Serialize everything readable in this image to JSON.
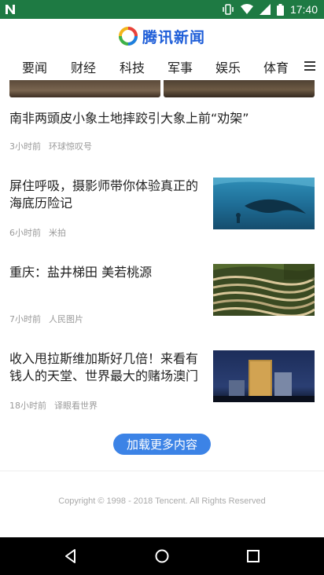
{
  "status_bar": {
    "time": "17:40"
  },
  "app": {
    "logo_text": "腾讯新闻"
  },
  "tabs": [
    {
      "label": "要闻"
    },
    {
      "label": "财经"
    },
    {
      "label": "科技"
    },
    {
      "label": "军事"
    },
    {
      "label": "娱乐"
    },
    {
      "label": "体育"
    }
  ],
  "stories": [
    {
      "title": "南非两頭皮小象土地摔跤引大象上前“劝架”",
      "time": "3小时前",
      "source": "环球惊叹号"
    },
    {
      "title": "屏住呼吸，摄影师带你体验真正的海底历险记",
      "time": "6小时前",
      "source": "米拍"
    },
    {
      "title": "重庆：盐井梯田 美若桃源",
      "time": "7小时前",
      "source": "人民图片"
    },
    {
      "title": "收入甩拉斯维加斯好几倍！来看有钱人的天堂、世界最大的赌场澳门",
      "time": "18小时前",
      "source": "译眼看世界"
    }
  ],
  "load_more": "加载更多内容",
  "footer": {
    "copyright": "Copyright © 1998 - 2018 Tencent. All Rights Reserved"
  },
  "colors": {
    "status_bar": "#1e7a43",
    "accent": "#3c83e6",
    "logo": "#1d5dd8"
  },
  "icons": [
    "notification-n-icon",
    "vibrate-icon",
    "wifi-icon",
    "signal-icon",
    "battery-icon",
    "menu-icon",
    "back-icon",
    "home-icon",
    "recent-apps-icon"
  ]
}
